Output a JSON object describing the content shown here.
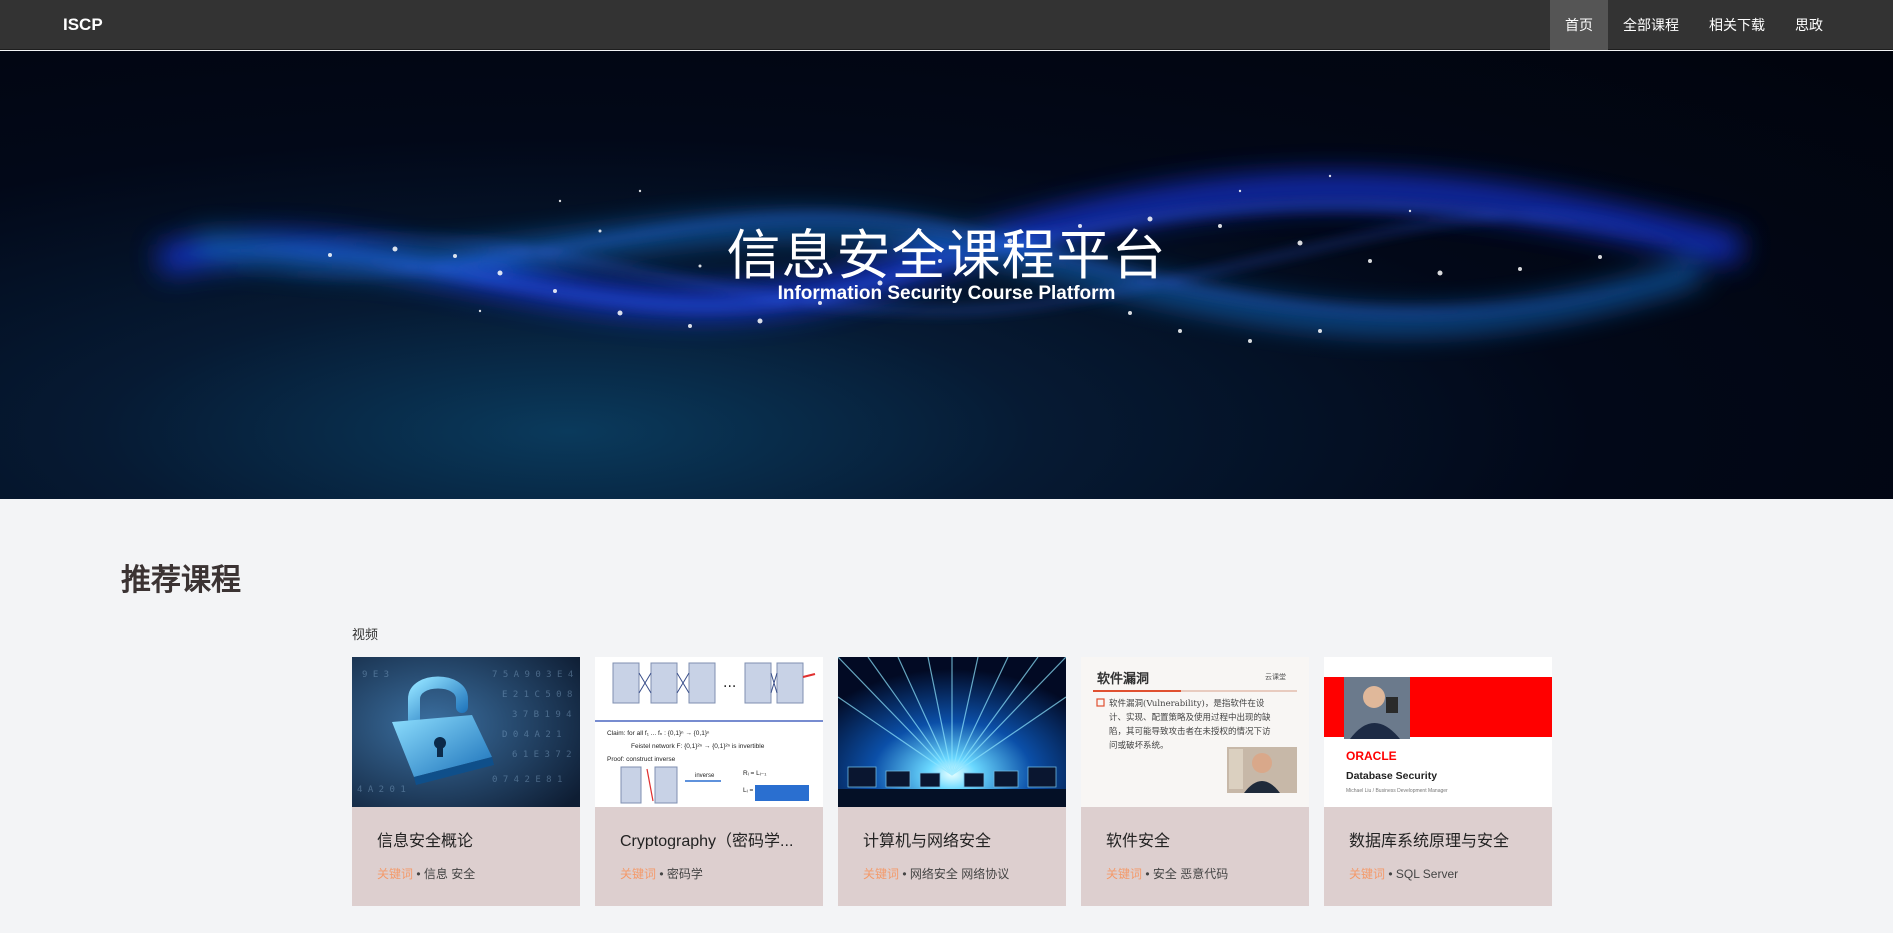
{
  "nav": {
    "brand": "ISCP",
    "items": [
      {
        "label": "首页",
        "active": true
      },
      {
        "label": "全部课程",
        "active": false
      },
      {
        "label": "相关下载",
        "active": false
      },
      {
        "label": "思政",
        "active": false
      }
    ]
  },
  "hero": {
    "title": "信息安全课程平台",
    "subtitle": "Information Security Course Platform"
  },
  "recommended": {
    "title": "推荐课程",
    "category": "视频",
    "keyword_label": "关键词",
    "separator": " • ",
    "courses": [
      {
        "title": "信息安全概论",
        "tags": "信息 安全",
        "thumb_icon": "padlock-icon"
      },
      {
        "title": "Cryptography（密码学...",
        "tags": "密码学",
        "thumb_icon": "feistel-network-icon"
      },
      {
        "title": "计算机与网络安全",
        "tags": "网络安全 网络协议",
        "thumb_icon": "network-tunnel-icon"
      },
      {
        "title": "软件安全",
        "tags": "安全 恶意代码",
        "thumb_icon": "slide-icon"
      },
      {
        "title": "数据库系统原理与安全",
        "tags": "SQL Server",
        "thumb_icon": "oracle-slide-icon"
      }
    ],
    "thumb_texts": {
      "feistel_claim": "Claim:  for all  f₁ ... fₙ : {0,1}ⁿ → {0,1}ⁿ",
      "feistel_net": "Feistel network  F: {0,1}²ⁿ → {0,1}²ⁿ  is invertible",
      "feistel_proof": "Proof:  construct inverse",
      "slide_title": "软件漏洞",
      "slide_brand": "云课堂",
      "slide_body_1": "软件漏洞(Vulnerability)，是指软件在设",
      "slide_body_2": "计、实现、配置策略及使用过程中出现的缺",
      "slide_body_3": "陷，其可能导致攻击者在未授权的情况下访",
      "slide_body_4": "问或破坏系统。",
      "oracle_logo": "ORACLE",
      "oracle_title": "Database Security",
      "oracle_author": "Michael Liu / Business Development Manager"
    }
  },
  "colors": {
    "topbar": "#333333",
    "card_bg": "#ddcfcf",
    "keyword": "#f49a6a",
    "oracle_red": "#ff0000"
  }
}
